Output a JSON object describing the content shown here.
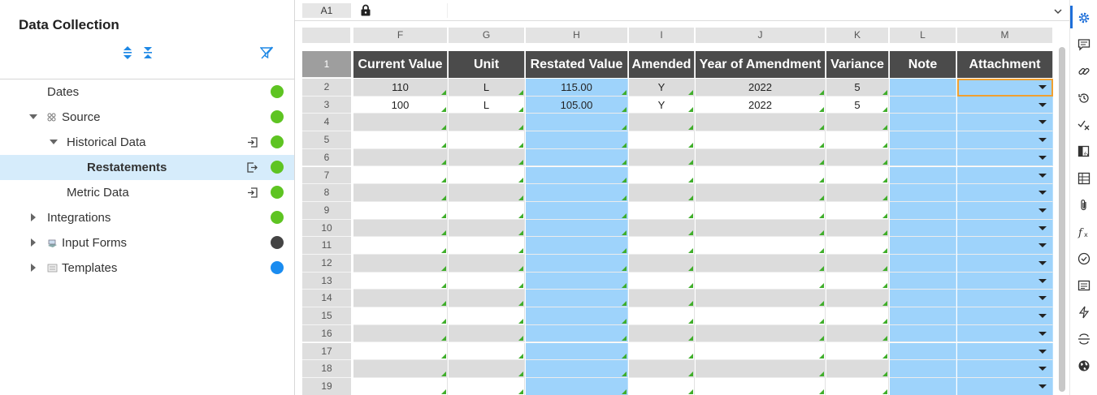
{
  "left_panel": {
    "title": "Data Collection",
    "tree": [
      {
        "label": "Dates",
        "status_color": "#5ec422"
      },
      {
        "label": "Source",
        "status_color": "#5ec422",
        "expanded": true
      },
      {
        "label": "Historical Data",
        "status_color": "#5ec422",
        "expanded": true
      },
      {
        "label": "Restatements",
        "status_color": "#5ec422",
        "selected": true
      },
      {
        "label": "Metric Data",
        "status_color": "#5ec422"
      },
      {
        "label": "Integrations",
        "status_color": "#5ec422"
      },
      {
        "label": "Input Forms",
        "status_color": "#444444"
      },
      {
        "label": "Templates",
        "status_color": "#1a8cf0"
      }
    ]
  },
  "formula_bar": {
    "cell_ref": "A1"
  },
  "sheet": {
    "column_letters": [
      "F",
      "G",
      "H",
      "I",
      "J",
      "K",
      "L",
      "M"
    ],
    "headers": [
      "Current Value",
      "Unit",
      "Restated Value",
      "Amended",
      "Year of Amendment",
      "Variance",
      "Note",
      "Attachment"
    ],
    "row_numbers": [
      "1",
      "2",
      "3",
      "4",
      "5",
      "6",
      "7",
      "8",
      "9",
      "10",
      "11",
      "12",
      "13",
      "14",
      "15",
      "16",
      "17",
      "18",
      "19"
    ],
    "rows": [
      [
        "110",
        "L",
        "115.00",
        "Y",
        "2022",
        "5",
        "",
        ""
      ],
      [
        "100",
        "L",
        "105.00",
        "Y",
        "2022",
        "5",
        "",
        ""
      ]
    ]
  },
  "rail_icons": [
    "gear-icon",
    "comment-icon",
    "link-icon",
    "history-icon",
    "check-x-icon",
    "formula-sheet-icon",
    "table-icon",
    "paperclip-icon",
    "function-icon",
    "check-circle-icon",
    "list-icon",
    "lightning-icon",
    "strikethrough-icon",
    "globe-icon"
  ]
}
